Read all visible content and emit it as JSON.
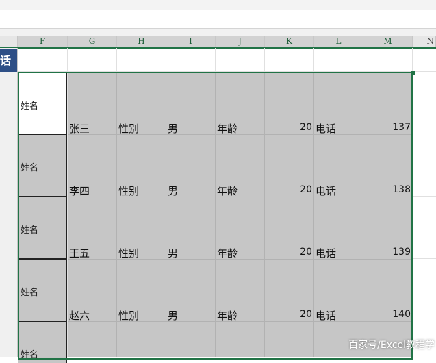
{
  "sheet": {
    "columns": [
      "F",
      "G",
      "H",
      "I",
      "J",
      "K",
      "L",
      "M"
    ],
    "partial_column": "N",
    "partial_header_text": "话",
    "records": [
      {
        "label": "姓名",
        "name": "张三",
        "gender_label": "性别",
        "gender": "男",
        "age_label": "年龄",
        "age": "20",
        "phone_label": "电话",
        "phone": "137"
      },
      {
        "label": "姓名",
        "name": "李四",
        "gender_label": "性别",
        "gender": "男",
        "age_label": "年龄",
        "age": "20",
        "phone_label": "电话",
        "phone": "138"
      },
      {
        "label": "姓名",
        "name": "王五",
        "gender_label": "性别",
        "gender": "男",
        "age_label": "年龄",
        "age": "20",
        "phone_label": "电话",
        "phone": "139"
      },
      {
        "label": "姓名",
        "name": "赵六",
        "gender_label": "性别",
        "gender": "男",
        "age_label": "年龄",
        "age": "20",
        "phone_label": "电话",
        "phone": "140"
      },
      {
        "label": "姓名"
      }
    ]
  },
  "watermark": "百家号/Excel教程学",
  "colors": {
    "selection": "#217346",
    "fill_gray": "#c6c6c6",
    "header_blue": "#2e4f86"
  }
}
